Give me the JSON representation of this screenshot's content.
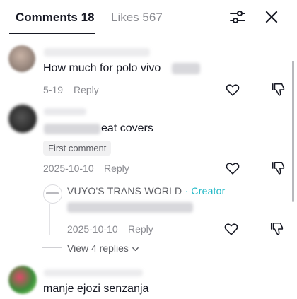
{
  "header": {
    "tab_comments": "Comments 18",
    "tab_likes": "Likes 567",
    "filter_icon": "filter-sliders-icon",
    "close_icon": "close-icon"
  },
  "comments": [
    {
      "text": "How much for polo vivo",
      "date": "5-19",
      "reply_label": "Reply"
    },
    {
      "text": "eat covers",
      "badge": "First comment",
      "date": "2025-10-10",
      "reply_label": "Reply",
      "reply": {
        "author": "VUYO'S TRANS WORLD",
        "author_tag": " · Creator",
        "date": "2025-10-10",
        "reply_label": "Reply"
      },
      "view_replies": "View 4 replies"
    },
    {
      "text": "manje ejozi senzanja"
    }
  ],
  "colors": {
    "accent_creator": "#20b8c6",
    "text_primary": "#161823",
    "text_secondary": "#8a8b91"
  }
}
